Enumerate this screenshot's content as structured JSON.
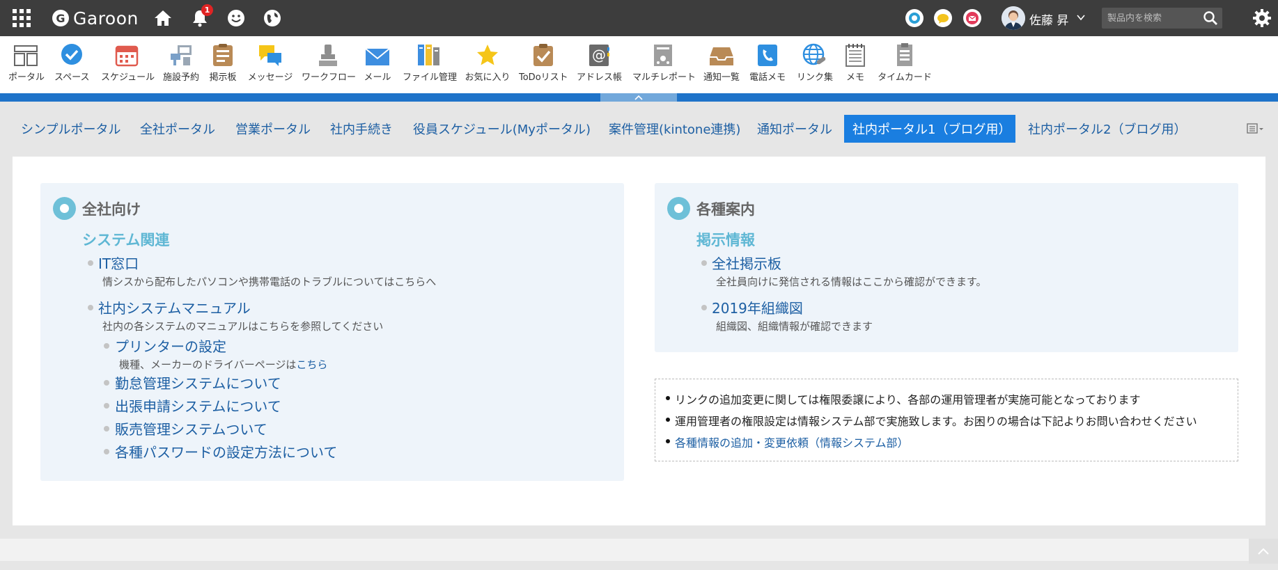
{
  "header": {
    "logo_text": "Garoon",
    "notification_count": "1",
    "user_name": "佐藤 昇",
    "search_placeholder": "製品内を検索"
  },
  "apps": [
    {
      "label": "ポータル",
      "icon": "portal-icon"
    },
    {
      "label": "スペース",
      "icon": "space-icon"
    },
    {
      "label": "スケジュール",
      "icon": "schedule-icon"
    },
    {
      "label": "施設予約",
      "icon": "facility-icon"
    },
    {
      "label": "掲示板",
      "icon": "bulletin-icon"
    },
    {
      "label": "メッセージ",
      "icon": "message-icon"
    },
    {
      "label": "ワークフロー",
      "icon": "workflow-icon"
    },
    {
      "label": "メール",
      "icon": "mail-icon"
    },
    {
      "label": "ファイル管理",
      "icon": "file-icon"
    },
    {
      "label": "お気に入り",
      "icon": "favorite-icon"
    },
    {
      "label": "ToDoリスト",
      "icon": "todo-icon"
    },
    {
      "label": "アドレス帳",
      "icon": "address-icon"
    },
    {
      "label": "マルチレポート",
      "icon": "report-icon"
    },
    {
      "label": "通知一覧",
      "icon": "notification-list-icon"
    },
    {
      "label": "電話メモ",
      "icon": "phone-memo-icon"
    },
    {
      "label": "リンク集",
      "icon": "links-icon"
    },
    {
      "label": "メモ",
      "icon": "memo-icon"
    },
    {
      "label": "タイムカード",
      "icon": "timecard-icon"
    }
  ],
  "tabs": [
    {
      "label": "シンプルポータル"
    },
    {
      "label": "全社ポータル"
    },
    {
      "label": "営業ポータル"
    },
    {
      "label": "社内手続き"
    },
    {
      "label": "役員スケジュール(Myポータル)"
    },
    {
      "label": "案件管理(kintone連携)"
    },
    {
      "label": "通知ポータル"
    },
    {
      "label": "社内ポータル1（ブログ用）",
      "active": true
    },
    {
      "label": "社内ポータル2（ブログ用）"
    }
  ],
  "left_panel": {
    "title": "全社向け",
    "subtitle": "システム関連",
    "items": [
      {
        "label": "IT窓口",
        "desc": "情シスから配布したパソコンや携帯電話のトラブルについてはこちらへ"
      },
      {
        "label": "社内システムマニュアル",
        "desc": "社内の各システムのマニュアルはこちらを参照してください"
      }
    ],
    "subitems": [
      {
        "label": "プリンターの設定",
        "desc": "機種、メーカーのドライバーページは",
        "desc_link": "こちら"
      },
      {
        "label": "勤怠管理システムについて"
      },
      {
        "label": "出張申請システムについて"
      },
      {
        "label": "販売管理システムついて"
      },
      {
        "label": "各種パスワードの設定方法について"
      }
    ]
  },
  "right_panel": {
    "title": "各種案内",
    "subtitle": "掲示情報",
    "items": [
      {
        "label": "全社掲示板",
        "desc": "全社員向けに発信される情報はここから確認ができます。"
      },
      {
        "label": "2019年組織図",
        "desc": "組織図、組織情報が確認できます"
      }
    ]
  },
  "notice": {
    "lines": [
      "リンクの追加変更に関しては権限委譲により、各部の運用管理者が実施可能となっております",
      "運用管理者の権限設定は情報システム部で実施致します。お困りの場合は下記よりお問い合わせください"
    ],
    "link": "各種情報の追加・変更依頼（情報システム部）"
  },
  "colors": {
    "header_bg": "#3d3d3d",
    "accent_blue": "#1a7ee0",
    "link": "#1d5fa3",
    "panel_bg": "#eef4fa",
    "subtitle": "#5fb7d4"
  }
}
